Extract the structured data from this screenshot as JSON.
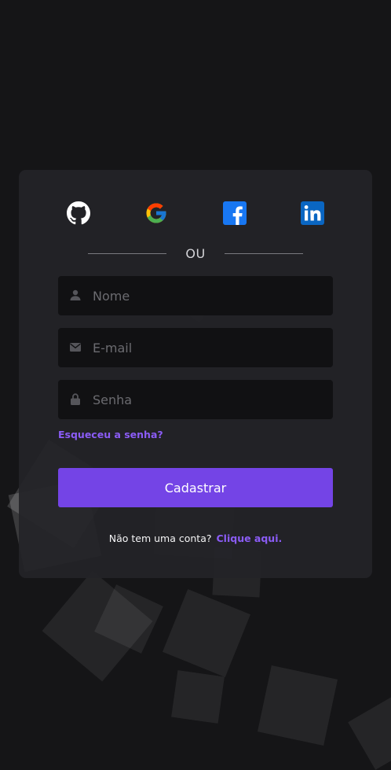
{
  "social": {
    "github": "GitHub",
    "google": "Google",
    "facebook": "Facebook",
    "linkedin": "LinkedIn"
  },
  "divider": {
    "text": "OU"
  },
  "form": {
    "name_placeholder": "Nome",
    "email_placeholder": "E-mail",
    "password_placeholder": "Senha",
    "forgot_password": "Esqueceu a senha?",
    "submit_label": "Cadastrar"
  },
  "footer": {
    "prompt": "Não tem uma conta?",
    "link": "Clique aqui."
  },
  "colors": {
    "background": "#151517",
    "card": "#242428",
    "input": "#111113",
    "accent": "#7444e6",
    "link": "#8b5cf6"
  },
  "icons": {
    "github": "github-icon",
    "google": "google-icon",
    "facebook": "facebook-icon",
    "linkedin": "linkedin-icon",
    "name_field": "user-icon",
    "email_field": "envelope-icon",
    "password_field": "lock-icon"
  }
}
